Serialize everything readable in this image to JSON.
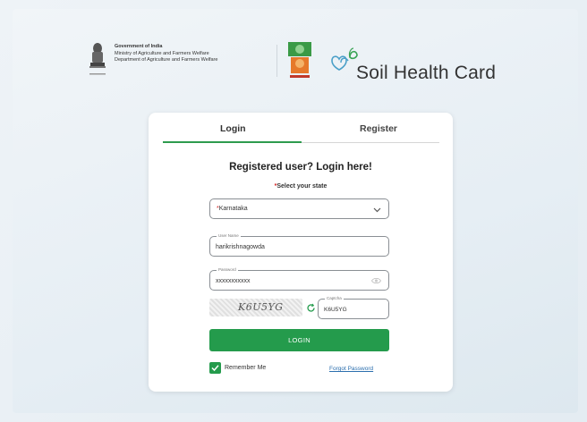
{
  "header": {
    "gov_line1": "Government of India",
    "gov_line2": "Ministry of Agriculture and Farmers Welfare",
    "gov_line3": "Department of Agriculture and Farmers Welfare",
    "emblem_icon": "national-emblem-icon",
    "logo_icon": "soil-health-logo-icon",
    "app_icon": "soil-health-card-icon",
    "app_title": "Soil Health Card"
  },
  "tabs": [
    {
      "label": "Login",
      "active": true
    },
    {
      "label": "Register",
      "active": false
    }
  ],
  "form": {
    "heading": "Registered user? Login here!",
    "state_label": "Select your state",
    "state_value": "Karnataka",
    "username_label": "User Name",
    "username_value": "harikrishnagowda",
    "password_label": "Password",
    "password_value": "xxxxxxxxxxx",
    "captcha_image_text": "K6U5YG",
    "captcha_label": "Captcha",
    "captcha_value": "K6U5YG",
    "login_label": "LOGIN",
    "remember_label": "Remember Me",
    "remember_checked": true,
    "forgot_label": "Forgot Password"
  },
  "colors": {
    "accent": "#249b4c",
    "link": "#2c6fae",
    "required": "#d21f1f"
  }
}
